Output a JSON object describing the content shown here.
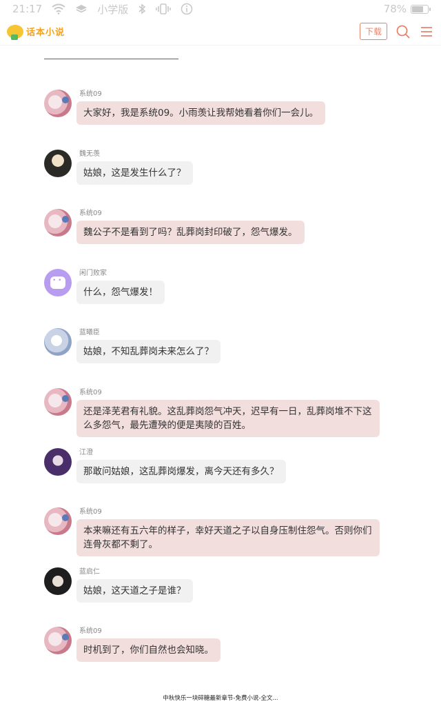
{
  "status_bar": {
    "time": "21:17",
    "network": "小学版",
    "battery_percent": 78,
    "battery_label": "78%"
  },
  "header": {
    "logo_text": "话本小说",
    "download_label": "下载",
    "search_icon": "search-icon",
    "menu_icon": "menu-icon"
  },
  "divider": "______________________________",
  "messages": [
    {
      "name": "系统09",
      "text": "大家好，我是系统09。小雨羡让我帮她看着你们一会儿。",
      "avatar": "system",
      "bubble": "pink"
    },
    {
      "name": "魏无羡",
      "text": "姑娘，这是发生什么了？",
      "avatar": "wei",
      "bubble": "gray"
    },
    {
      "name": "系统09",
      "text": "魏公子不是看到了吗？乱葬岗封印破了，怨气爆发。",
      "avatar": "system",
      "bubble": "pink"
    },
    {
      "name": "闲门败家",
      "text": "什么，怨气爆发！",
      "avatar": "xianmen",
      "bubble": "gray"
    },
    {
      "name": "蓝曦臣",
      "text": "姑娘，不知乱葬岗未来怎么了？",
      "avatar": "lan",
      "bubble": "gray"
    },
    {
      "name": "系统09",
      "text": "还是泽芜君有礼貌。这乱葬岗怨气冲天，迟早有一日，乱葬岗堆不下这么多怨气，最先遭殃的便是夷陵的百姓。",
      "avatar": "system",
      "bubble": "pink"
    },
    {
      "name": "江澄",
      "text": "那敢问姑娘，这乱葬岗爆发，离今天还有多久？",
      "avatar": "jiang",
      "bubble": "gray"
    },
    {
      "name": "系统09",
      "text": "本来嘛还有五六年的样子，幸好天道之子以自身压制住怨气。否则你们连骨灰都不剩了。",
      "avatar": "system",
      "bubble": "pink"
    },
    {
      "name": "蓝启仁",
      "text": "姑娘，这天道之子是谁？",
      "avatar": "qiren",
      "bubble": "gray"
    },
    {
      "name": "系统09",
      "text": "时机到了，你们自然也会知晓。",
      "avatar": "system",
      "bubble": "pink"
    }
  ],
  "footer_title": "中秋快乐一块碎糖最新章节-免费小说-全文..."
}
